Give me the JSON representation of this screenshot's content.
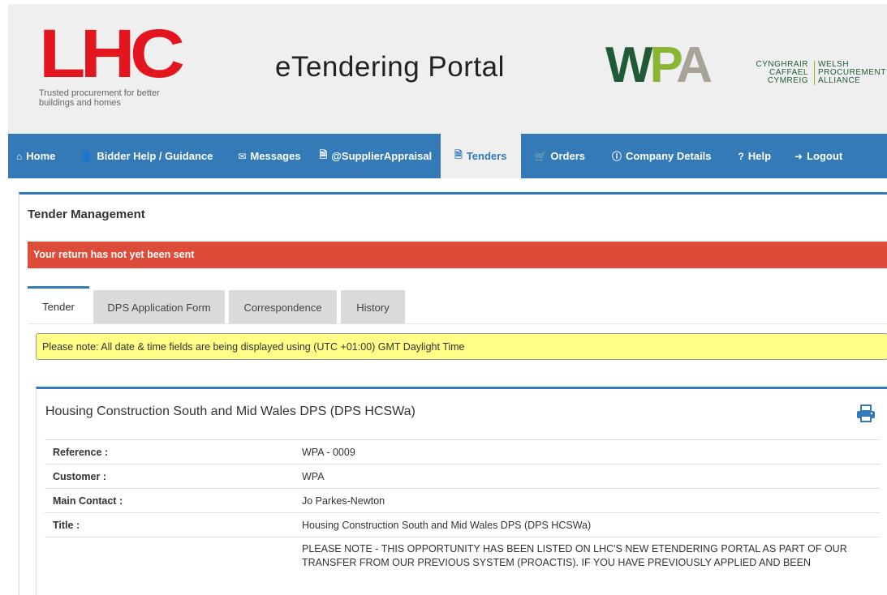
{
  "header": {
    "lhc_logo": "LHC",
    "lhc_tagline": "Trusted procurement for better buildings and homes",
    "portal_title": "eTendering Portal",
    "wpa_logo": {
      "w": "W",
      "p": "P",
      "a": "A"
    },
    "wpa_welsh": "CYNGHRAIR CAFFAEL CYMREIG",
    "wpa_english": "WELSH PROCUREMENT ALLIANCE"
  },
  "nav": {
    "items": [
      {
        "icon": "home-icon",
        "glyph": "⌂",
        "label": "Home"
      },
      {
        "icon": "user-icon",
        "glyph": "👤",
        "label": "Bidder Help / Guidance"
      },
      {
        "icon": "envelope-icon",
        "glyph": "✉",
        "label": "Messages"
      },
      {
        "icon": "file-icon",
        "glyph": "🗎",
        "label": "@SupplierAppraisal"
      },
      {
        "icon": "file-text-icon",
        "glyph": "🗎",
        "label": "Tenders"
      },
      {
        "icon": "cart-icon",
        "glyph": "🛒",
        "label": "Orders"
      },
      {
        "icon": "info-icon",
        "glyph": "ⓘ",
        "label": "Company Details"
      },
      {
        "icon": "question-icon",
        "glyph": "?",
        "label": "Help"
      },
      {
        "icon": "logout-icon",
        "glyph": "➜",
        "label": "Logout"
      }
    ],
    "active": "Tenders"
  },
  "page": {
    "title": "Tender Management",
    "alert": "Your return has not yet been sent",
    "tabs": [
      "Tender",
      "DPS Application Form",
      "Correspondence",
      "History"
    ],
    "active_tab": "Tender",
    "timezone_note": "Please note: All date & time fields are being displayed using (UTC +01:00) GMT Daylight Time"
  },
  "tender": {
    "title": "Housing Construction South and Mid Wales DPS (DPS HCSWa)",
    "rows": [
      {
        "label": "Reference :",
        "value": "WPA - 0009"
      },
      {
        "label": "Customer :",
        "value": "WPA"
      },
      {
        "label": "Main Contact :",
        "value": "Jo Parkes-Newton"
      },
      {
        "label": "Title :",
        "value": "Housing Construction South and Mid Wales DPS (DPS HCSWa)"
      }
    ],
    "note": "PLEASE NOTE - THIS OPPORTUNITY HAS BEEN LISTED ON LHC'S NEW ETENDERING PORTAL AS PART OF OUR TRANSFER FROM OUR PREVIOUS SYSTEM (PROACTIS). IF YOU HAVE PREVIOUSLY APPLIED AND BEEN"
  },
  "colors": {
    "nav": "#337ab7",
    "alert_red": "#dd4b39",
    "alert_yellow": "#ffff88",
    "lhc_red": "#e3161f",
    "wpa_green": "#1e5b36",
    "wpa_lime": "#8ab636"
  }
}
